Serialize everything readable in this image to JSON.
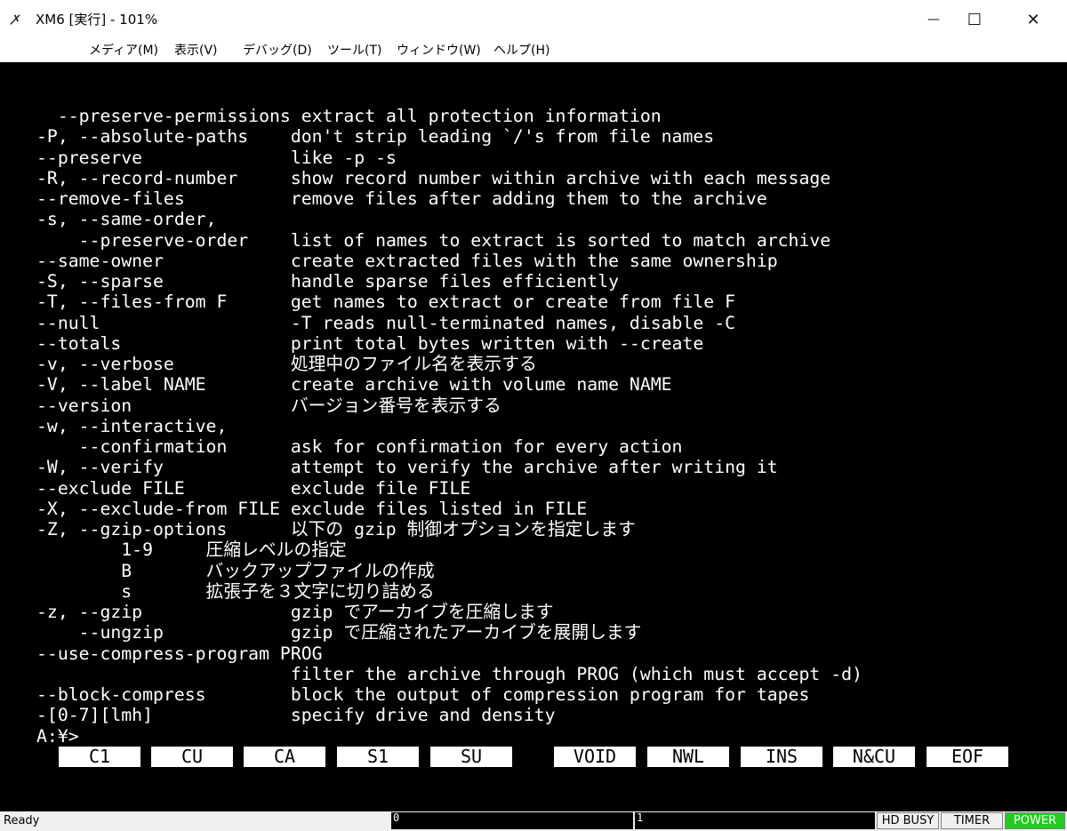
{
  "window": {
    "title": "XM6 [実行] - 101%",
    "icon_glyph": "ꭗ",
    "minimize_glyph": "—",
    "maximize_glyph": "☐",
    "close_glyph": "✕"
  },
  "menu": [
    "メディア(M)",
    "表示(V)",
    "デバッグ(D)",
    "ツール(T)",
    "ウィンドウ(W)",
    "ヘルプ(H)"
  ],
  "terminal": {
    "lines": [
      "  --preserve-permissions extract all protection information",
      "-P, --absolute-paths    don't strip leading `/'s from file names",
      "--preserve              like -p -s",
      "-R, --record-number     show record number within archive with each message",
      "--remove-files          remove files after adding them to the archive",
      "-s, --same-order,",
      "    --preserve-order    list of names to extract is sorted to match archive",
      "--same-owner            create extracted files with the same ownership",
      "-S, --sparse            handle sparse files efficiently",
      "-T, --files-from F      get names to extract or create from file F",
      "--null                  -T reads null-terminated names, disable -C",
      "--totals                print total bytes written with --create",
      "-v, --verbose           処理中のファイル名を表示する",
      "-V, --label NAME        create archive with volume name NAME",
      "--version               バージョン番号を表示する",
      "-w, --interactive,",
      "    --confirmation      ask for confirmation for every action",
      "-W, --verify            attempt to verify the archive after writing it",
      "--exclude FILE          exclude file FILE",
      "-X, --exclude-from FILE exclude files listed in FILE",
      "-Z, --gzip-options      以下の gzip 制御オプションを指定します",
      "        1-9     圧縮レベルの指定",
      "        B       バックアップファイルの作成",
      "        s       拡張子を３文字に切り詰める",
      "-z, --gzip              gzip でアーカイブを圧縮します",
      "    --ungzip            gzip で圧縮されたアーカイブを展開します",
      "--use-compress-program PROG",
      "                        filter the archive through PROG (which must accept -d)",
      "--block-compress        block the output of compression program for tapes",
      "-[0-7][lmh]             specify drive and density",
      "A:¥>"
    ]
  },
  "function_keys": [
    "C1",
    "CU",
    "CA",
    "S1",
    "SU",
    "VOID",
    "NWL",
    "INS",
    "N&CU",
    "EOF"
  ],
  "status": {
    "ready": "Ready",
    "field1": "0",
    "field2": "1",
    "hd_busy": "HD BUSY",
    "timer": "TIMER",
    "power": "POWER",
    "power_color": "#22cc22"
  }
}
